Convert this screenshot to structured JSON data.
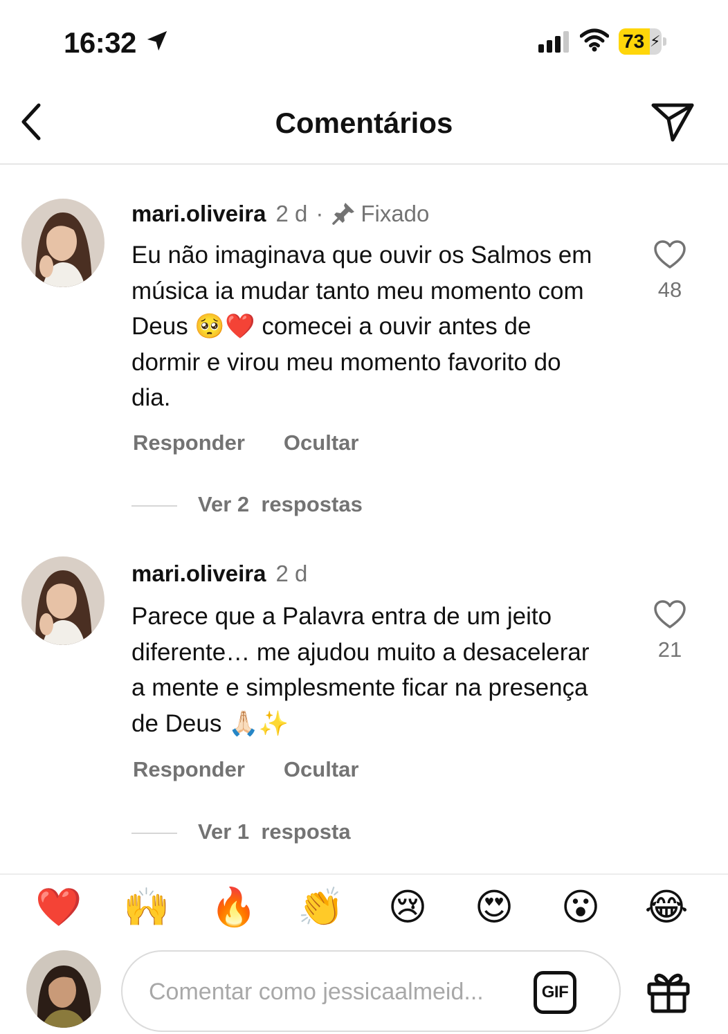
{
  "status_bar": {
    "time": "16:32",
    "battery_level": "73",
    "battery_fraction": 0.73,
    "icons": [
      "location-arrow-icon",
      "cellular-signal-icon",
      "wifi-icon",
      "battery-charging-icon"
    ]
  },
  "header": {
    "title": "Comentários",
    "back_icon": "chevron-left-icon",
    "share_icon": "paper-plane-icon"
  },
  "comments": [
    {
      "username": "mari.oliveira",
      "time_ago": "2 d",
      "separator": "·",
      "pinned_label": "Fixado",
      "pin_icon": "pin-icon",
      "text": "Eu não imaginava que ouvir os Salmos em música ia mudar tanto meu momento com Deus 🥺❤️ comecei a ouvir antes de dormir e virou meu momento favorito do dia.",
      "likes": "48",
      "reply_label": "Responder",
      "hide_label": "Ocultar",
      "view_replies": "Ver 2  respostas"
    },
    {
      "username": "mari.oliveira",
      "time_ago": "2 d",
      "text": "Parece que a Palavra entra de um jeito diferente… me ajudou muito a desacelerar a mente e simplesmente ficar na presença de Deus 🙏🏻✨",
      "likes": "21",
      "reply_label": "Responder",
      "hide_label": "Ocultar",
      "view_replies": "Ver 1  resposta"
    }
  ],
  "emoji_bar": [
    "❤️",
    "🙌",
    "🔥",
    "👏",
    "😢",
    "😍",
    "😮",
    "😂"
  ],
  "composer": {
    "placeholder": "Comentar como jessicaalmeid...",
    "gif_label": "GIF",
    "gift_icon": "gift-icon"
  },
  "colors": {
    "text": "#111111",
    "secondary": "#737373",
    "divider": "#e6e6e6",
    "battery": "#ffd60a",
    "heart": "#e0245e"
  }
}
